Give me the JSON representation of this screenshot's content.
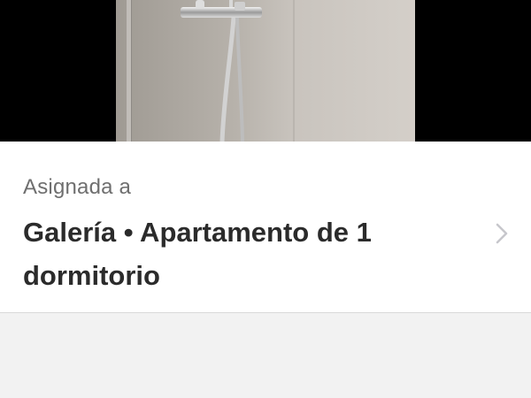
{
  "photo": {
    "icon": "shower-icon",
    "alt": ""
  },
  "assignment": {
    "label": "Asignada a",
    "value": "Galería • Apartamento de 1 dormitorio",
    "chevron_icon": "chevron-right-icon"
  },
  "colors": {
    "label_text": "#6f6f6f",
    "value_text": "#2b2b2b",
    "chevron": "#c7c7cc",
    "background": "#f2f2f2",
    "card": "#ffffff"
  }
}
